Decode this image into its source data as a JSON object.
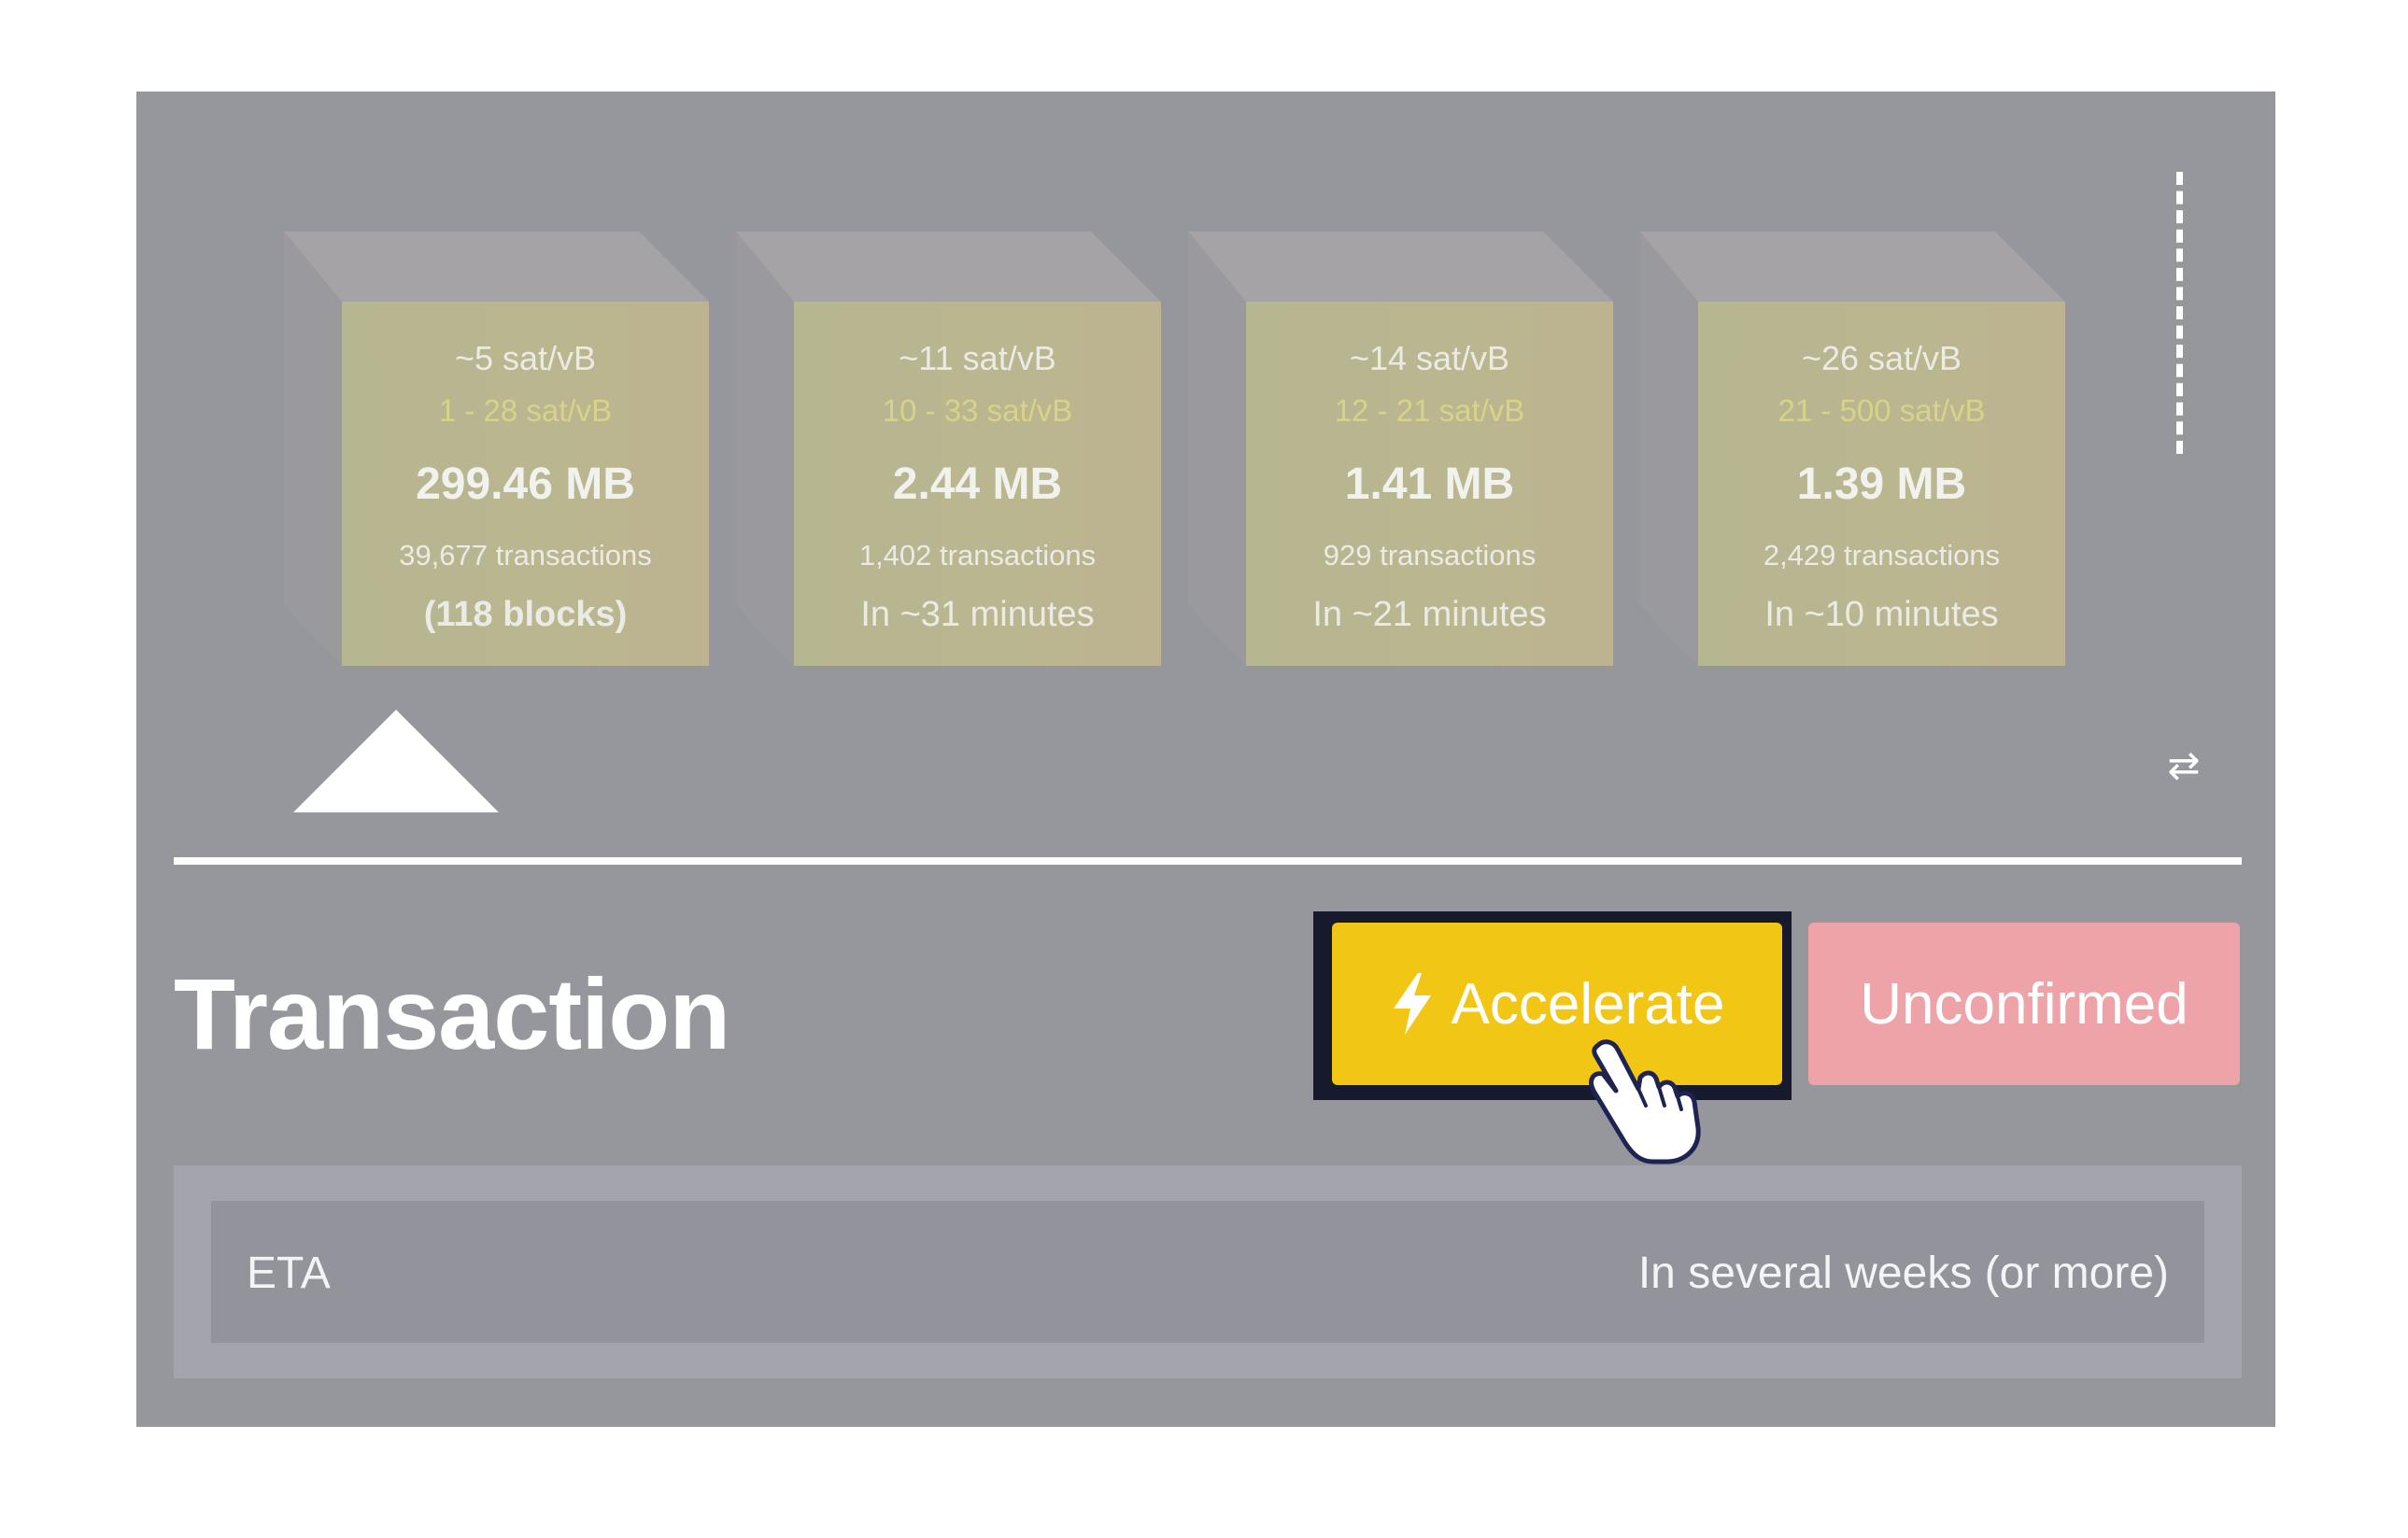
{
  "mempool_blocks": [
    {
      "median_fee": "~5 sat/vB",
      "fee_range": "1 - 28 sat/vB",
      "size": "299.46 MB",
      "transactions": "39,677 transactions",
      "eta": "(118 blocks)"
    },
    {
      "median_fee": "~11 sat/vB",
      "fee_range": "10 - 33 sat/vB",
      "size": "2.44 MB",
      "transactions": "1,402 transactions",
      "eta": "In ~31 minutes"
    },
    {
      "median_fee": "~14 sat/vB",
      "fee_range": "12 - 21 sat/vB",
      "size": "1.41 MB",
      "transactions": "929 transactions",
      "eta": "In ~21 minutes"
    },
    {
      "median_fee": "~26 sat/vB",
      "fee_range": "21 - 500 sat/vB",
      "size": "1.39 MB",
      "transactions": "2,429 transactions",
      "eta": "In ~10 minutes"
    }
  ],
  "icons": {
    "swap": "swap-arrows-icon",
    "bolt": "lightning-bolt-icon",
    "cursor": "hand-pointer-cursor"
  },
  "header": {
    "title": "Transaction",
    "accelerate_label": "Accelerate",
    "status": "Unconfirmed"
  },
  "details": [
    {
      "label": "ETA",
      "value": "In several weeks (or more)"
    }
  ],
  "colors": {
    "panel_bg": "#96979c",
    "accelerate": "#f1c615",
    "accelerate_outline": "#17192c",
    "unconfirmed": "#eea3a8"
  }
}
